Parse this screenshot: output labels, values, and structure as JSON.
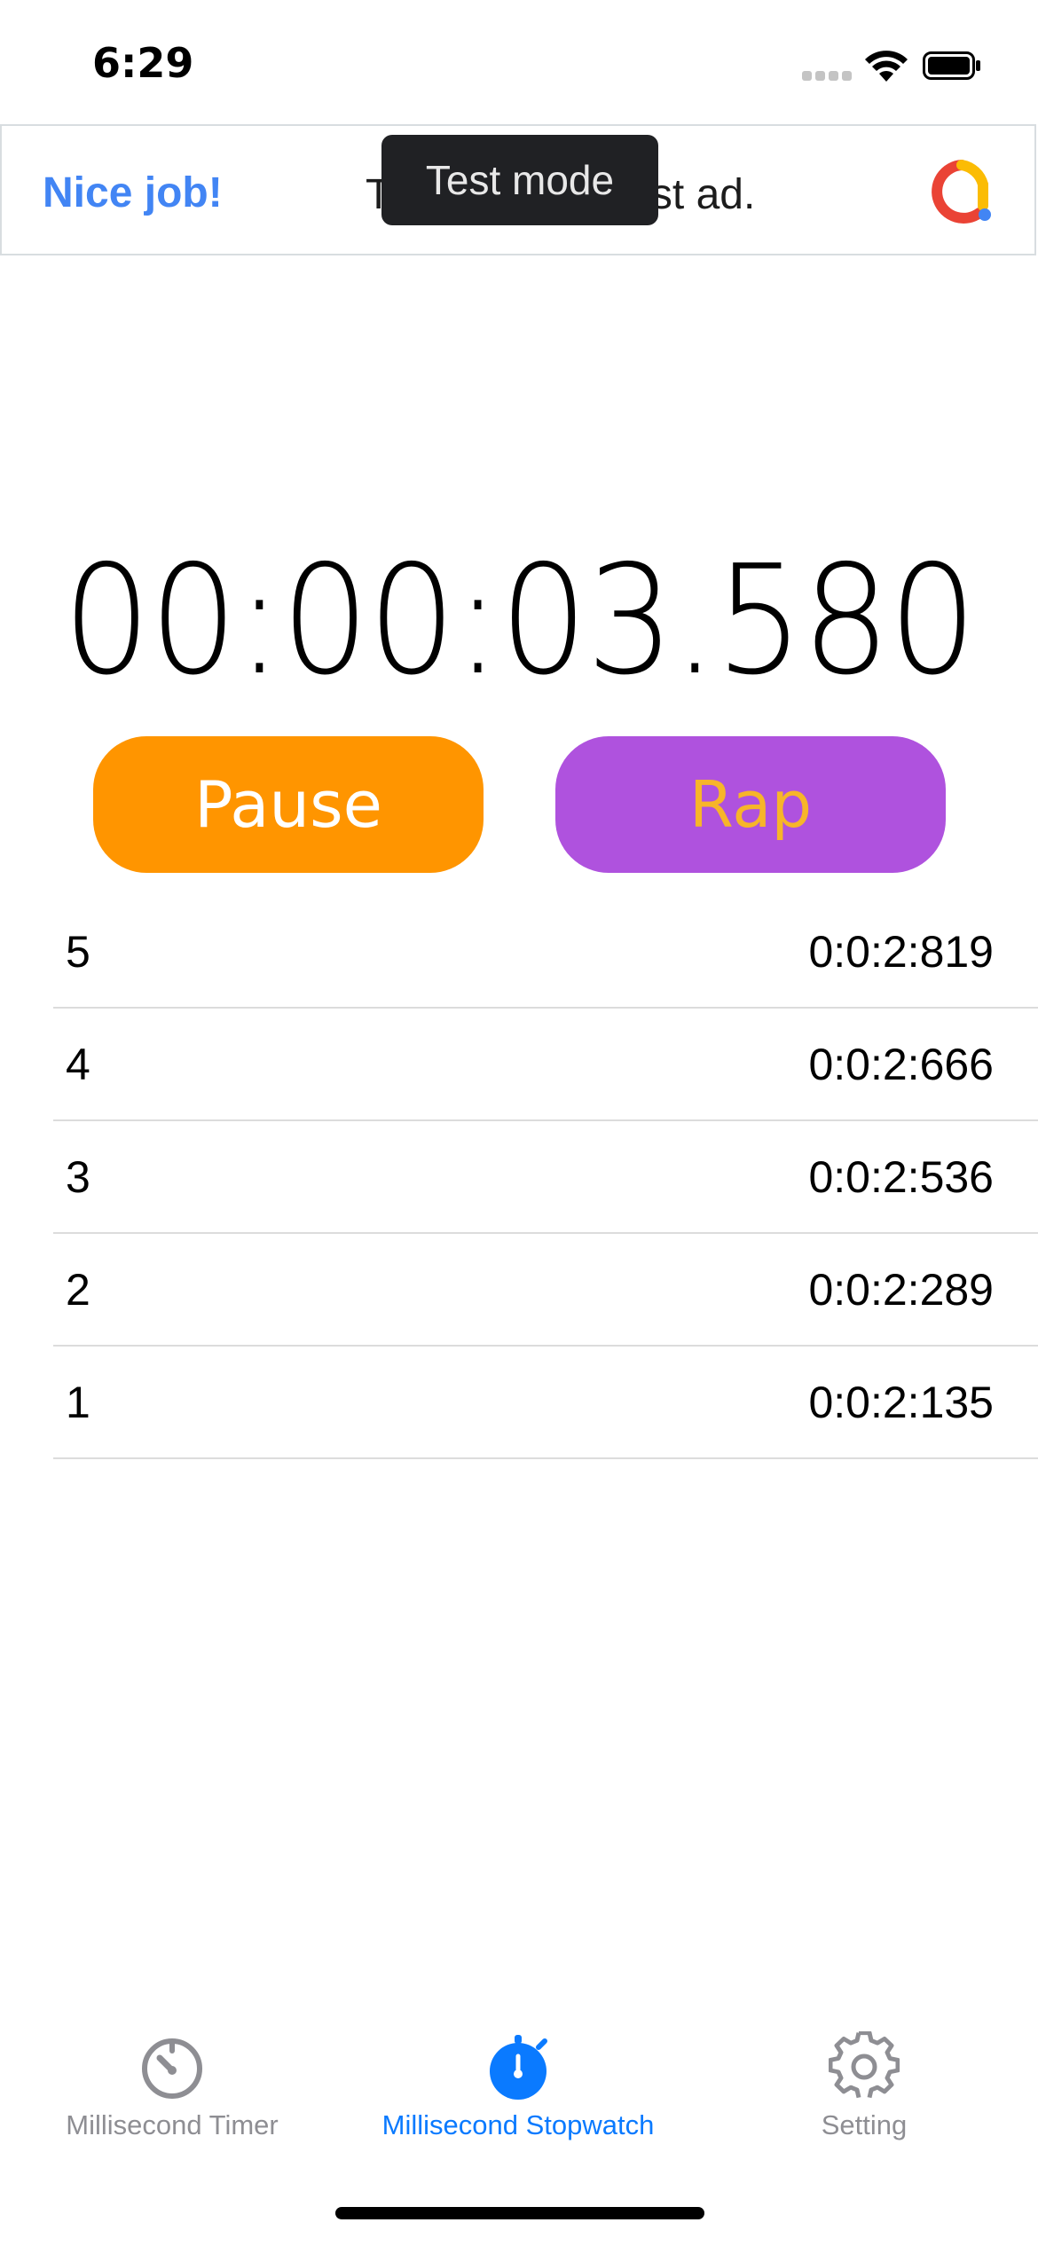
{
  "status_bar": {
    "time": "6:29"
  },
  "ad_banner": {
    "headline": "Nice job!",
    "body": "T                0 test ad.",
    "tooltip": "Test mode",
    "colors": {
      "headline": "#4285f4"
    }
  },
  "stopwatch": {
    "display": "00:00:03.580",
    "pause_label": "Pause",
    "rap_label": "Rap",
    "colors": {
      "pause_bg": "#ff9500",
      "rap_bg": "#af52de",
      "rap_text": "#f7b529"
    }
  },
  "laps": [
    {
      "index": "5",
      "time": "0:0:2:819"
    },
    {
      "index": "4",
      "time": "0:0:2:666"
    },
    {
      "index": "3",
      "time": "0:0:2:536"
    },
    {
      "index": "2",
      "time": "0:0:2:289"
    },
    {
      "index": "1",
      "time": "0:0:2:135"
    }
  ],
  "tab_bar": {
    "items": [
      {
        "label": "Millisecond Timer",
        "icon": "timer-icon",
        "active": false
      },
      {
        "label": "Millisecond Stopwatch",
        "icon": "stopwatch-icon",
        "active": true
      },
      {
        "label": "Setting",
        "icon": "gear-icon",
        "active": false
      }
    ],
    "colors": {
      "active": "#0a7aff",
      "inactive": "#8e8e93"
    }
  }
}
